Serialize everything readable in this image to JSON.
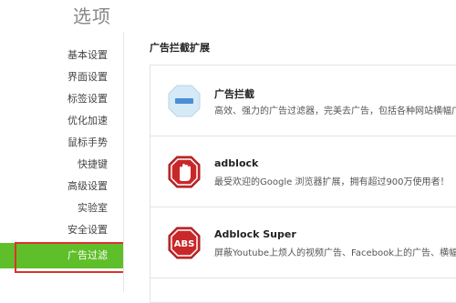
{
  "header": {
    "title": "选项"
  },
  "sidebar": {
    "items": [
      {
        "label": "基本设置"
      },
      {
        "label": "界面设置"
      },
      {
        "label": "标签设置"
      },
      {
        "label": "优化加速"
      },
      {
        "label": "鼠标手势"
      },
      {
        "label": "快捷键"
      },
      {
        "label": "高级设置"
      },
      {
        "label": "实验室"
      },
      {
        "label": "安全设置"
      },
      {
        "label": "广告过滤"
      }
    ],
    "active_color": "#5fbf2a"
  },
  "main": {
    "section_title": "广告拦截扩展",
    "extensions": [
      {
        "name": "广告拦截",
        "description": "高效、强力的广告过滤器，完美去广告，包括各种网站横幅广告，",
        "icon": "minus-badge-icon"
      },
      {
        "name": "adblock",
        "description": "最受欢迎的Google 浏览器扩展，拥有超过900万使用者！",
        "icon": "stop-hand-icon"
      },
      {
        "name": "Adblock Super",
        "description": "屏蔽Youtube上烦人的视频广告、Facebook上的广告、横幅广告",
        "icon": "abs-stop-icon"
      }
    ]
  },
  "colors": {
    "accent": "#5fbf2a",
    "highlight": "#e03030",
    "stop_red": "#c8282a"
  }
}
